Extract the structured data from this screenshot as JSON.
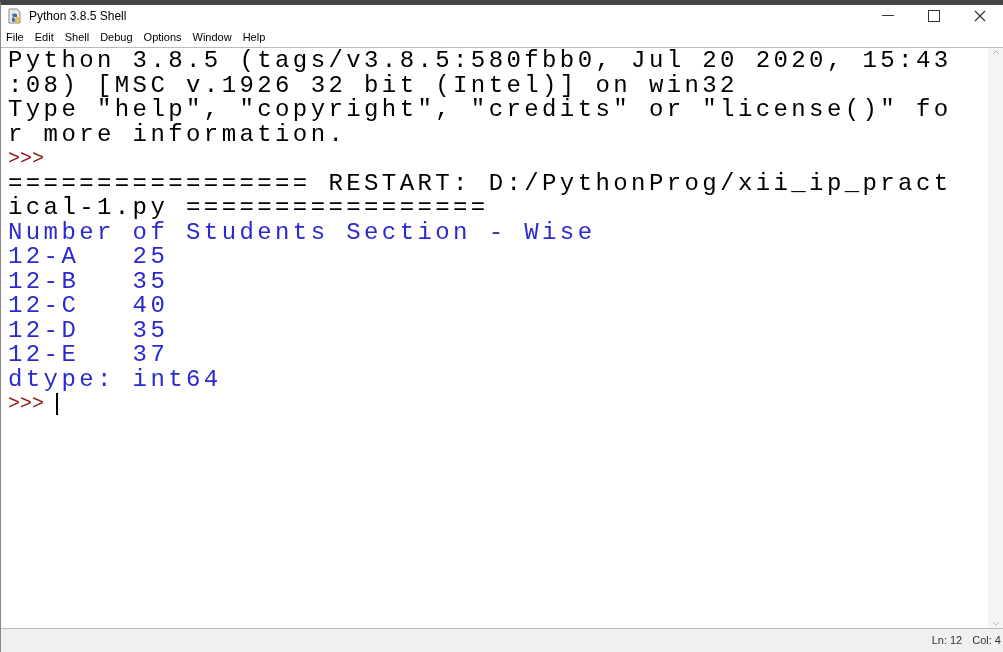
{
  "window": {
    "title": "Python 3.8.5 Shell"
  },
  "menu": [
    "File",
    "Edit",
    "Shell",
    "Debug",
    "Options",
    "Window",
    "Help"
  ],
  "lines": [
    {
      "kind": "output",
      "text": "Python 3.8.5 (tags/v3.8.5:580fbb0, Jul 20 2020, 15:43"
    },
    {
      "kind": "output",
      "text": ":08) [MSC v.1926 32 bit (Intel)] on win32"
    },
    {
      "kind": "output",
      "text": "Type \"help\", \"copyright\", \"credits\" or \"license()\" fo"
    },
    {
      "kind": "output",
      "text": "r more information."
    },
    {
      "kind": "prompt",
      "text": ">>>",
      "cursor": false
    },
    {
      "kind": "output",
      "text": "================= RESTART: D:/PythonProg/xii_ip_pract"
    },
    {
      "kind": "output",
      "text": "ical-1.py ================="
    },
    {
      "kind": "stdout",
      "text": "Number of Students Section - Wise"
    },
    {
      "kind": "stdout",
      "text": "12-A   25"
    },
    {
      "kind": "stdout",
      "text": "12-B   35"
    },
    {
      "kind": "stdout",
      "text": "12-C   40"
    },
    {
      "kind": "stdout",
      "text": "12-D   35"
    },
    {
      "kind": "stdout",
      "text": "12-E   37"
    },
    {
      "kind": "stdout",
      "text": "dtype: int64"
    },
    {
      "kind": "prompt",
      "text": ">>>",
      "cursor": true
    }
  ],
  "status_bar": {
    "line": "Ln: 12",
    "col": "Col: 4"
  }
}
